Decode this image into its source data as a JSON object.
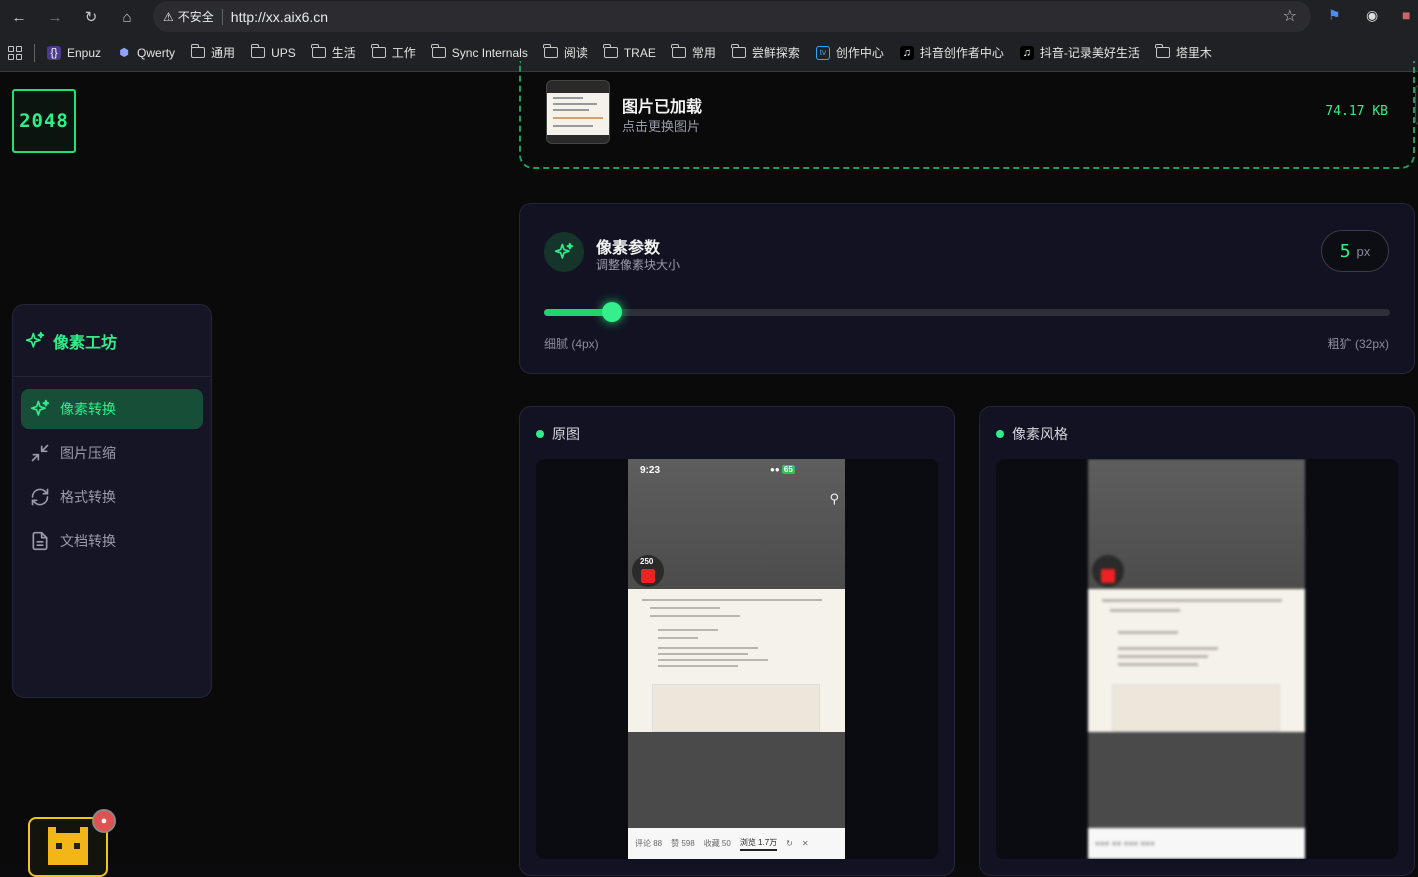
{
  "browser": {
    "security_label": "不安全",
    "url": "http://xx.aix6.cn",
    "bookmarks": [
      {
        "label": "Enpuz",
        "icon": "braces-icon"
      },
      {
        "label": "Qwerty",
        "icon": "cube-icon"
      },
      {
        "label": "通用",
        "icon": "folder-icon"
      },
      {
        "label": "UPS",
        "icon": "folder-icon"
      },
      {
        "label": "生活",
        "icon": "folder-icon"
      },
      {
        "label": "工作",
        "icon": "folder-icon"
      },
      {
        "label": "Sync Internals",
        "icon": "folder-icon"
      },
      {
        "label": "阅读",
        "icon": "folder-icon"
      },
      {
        "label": "TRAE",
        "icon": "folder-icon"
      },
      {
        "label": "常用",
        "icon": "folder-icon"
      },
      {
        "label": "尝鲜探索",
        "icon": "folder-icon"
      },
      {
        "label": "创作中心",
        "icon": "bilibili-icon"
      },
      {
        "label": "抖音创作者中心",
        "icon": "tiktok-icon"
      },
      {
        "label": "抖音-记录美好生活",
        "icon": "tiktok-icon"
      },
      {
        "label": "塔里木",
        "icon": "folder-icon"
      }
    ]
  },
  "app": {
    "logo": "2048",
    "brand": "像素工坊",
    "menu": [
      {
        "label": "像素转换",
        "icon": "sparkles-icon",
        "active": true
      },
      {
        "label": "图片压缩",
        "icon": "compress-icon",
        "active": false
      },
      {
        "label": "格式转换",
        "icon": "refresh-icon",
        "active": false
      },
      {
        "label": "文档转换",
        "icon": "document-icon",
        "active": false
      }
    ]
  },
  "upload": {
    "title": "图片已加载",
    "subtitle": "点击更换图片",
    "size": "74.17 KB"
  },
  "params": {
    "title": "像素参数",
    "subtitle": "调整像素块大小",
    "value": "5",
    "unit": "px",
    "min": 4,
    "max": 32,
    "current": 5,
    "min_label": "细腻 (4px)",
    "max_label": "粗犷 (32px)"
  },
  "preview": {
    "original_label": "原图",
    "pixel_label": "像素风格",
    "phone": {
      "time": "9:23",
      "coin": "250",
      "battery": "65",
      "bar": [
        "评论 88",
        "赞 598",
        "收藏 50",
        "浏览 1.7万"
      ]
    }
  },
  "colors": {
    "accent": "#2ef08a",
    "active_bg": "#174e37",
    "card_bg": "#121222"
  }
}
